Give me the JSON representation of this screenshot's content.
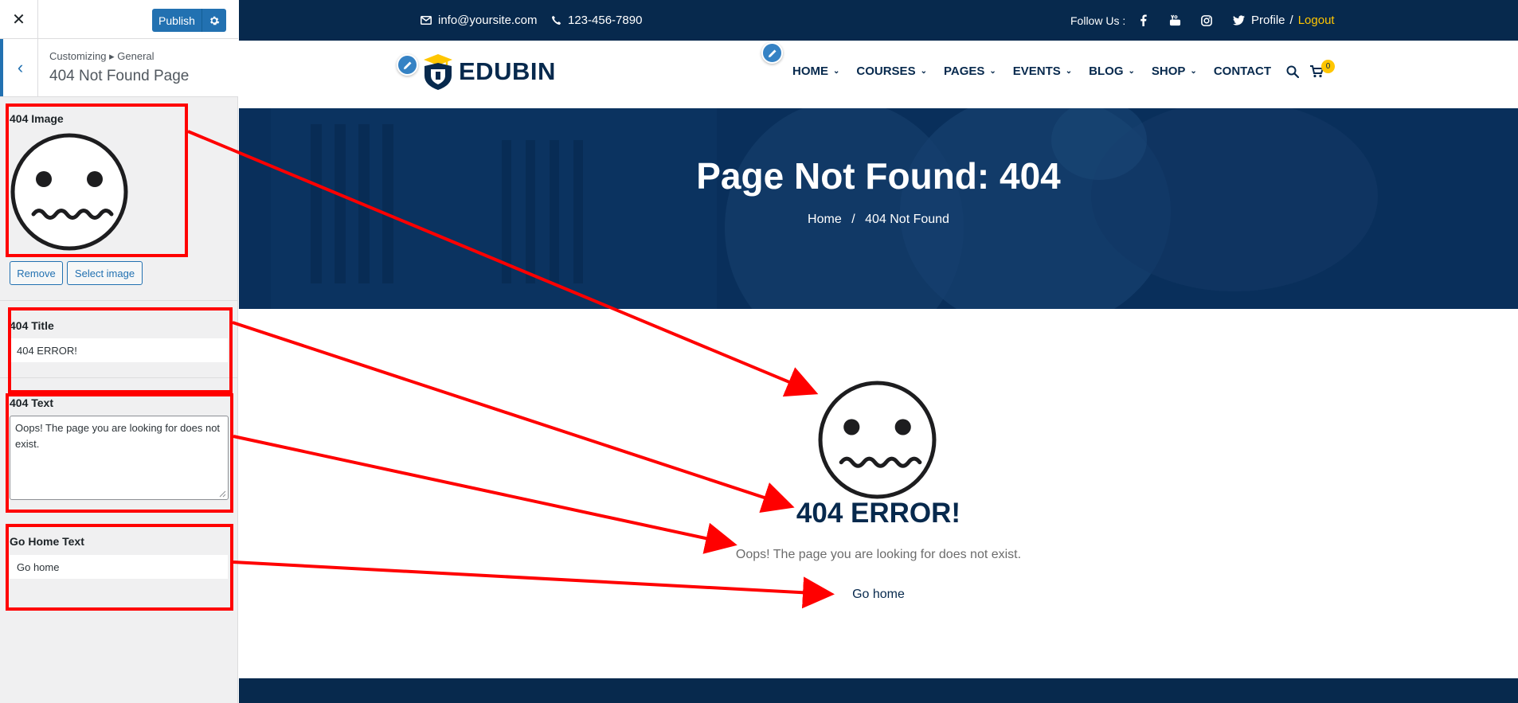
{
  "customizer": {
    "close_icon": "close-icon",
    "publish_label": "Publish",
    "breadcrumb": "Customizing ▸ General",
    "section_title": "404 Not Found Page",
    "controls": {
      "image_label": "404 Image",
      "remove_label": "Remove",
      "select_image_label": "Select image",
      "title_label": "404 Title",
      "title_value": "404 ERROR!",
      "text_label": "404 Text",
      "text_value": "Oops! The page you are looking for does not exist.",
      "go_home_label": "Go Home Text",
      "go_home_value": "Go home"
    }
  },
  "site": {
    "topbar": {
      "email": "info@yoursite.com",
      "phone": "123-456-7890",
      "follow_label": "Follow Us :",
      "profile": "Profile",
      "separator": "/",
      "logout": "Logout",
      "socials": [
        "facebook-icon",
        "youtube-icon",
        "instagram-icon",
        "twitter-icon"
      ]
    },
    "logo_text": "EDUBIN",
    "menu": [
      {
        "label": "HOME",
        "dropdown": true
      },
      {
        "label": "COURSES",
        "dropdown": true
      },
      {
        "label": "PAGES",
        "dropdown": true
      },
      {
        "label": "EVENTS",
        "dropdown": true
      },
      {
        "label": "BLOG",
        "dropdown": true
      },
      {
        "label": "SHOP",
        "dropdown": true
      },
      {
        "label": "CONTACT",
        "dropdown": false
      }
    ],
    "cart_count": "0",
    "hero": {
      "title": "Page Not Found: 404",
      "crumb_home": "Home",
      "crumb_sep": "/",
      "crumb_current": "404 Not Found"
    },
    "content": {
      "error_title": "404 ERROR!",
      "error_text": "Oops! The page you are looking for does not exist.",
      "go_home": "Go home"
    }
  },
  "colors": {
    "navy": "#07294d",
    "accent_yellow": "#ffc600",
    "wp_blue": "#2271b1",
    "annotation_red": "#ff0000"
  }
}
